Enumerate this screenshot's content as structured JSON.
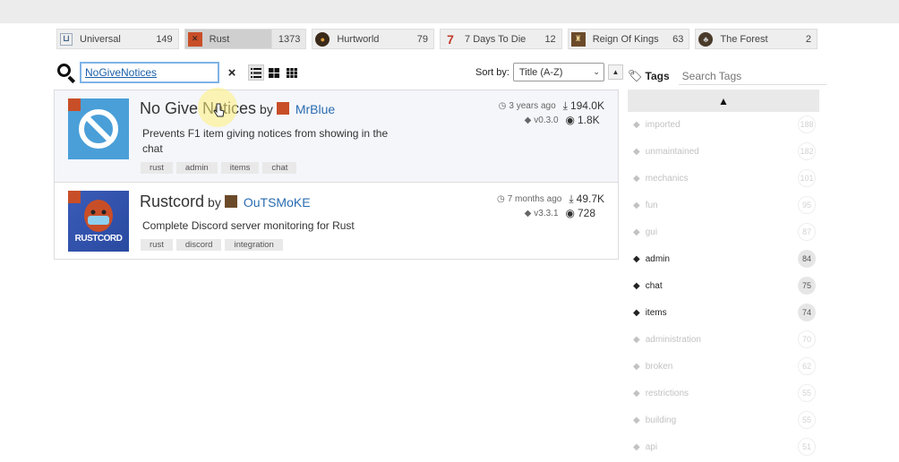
{
  "games": [
    {
      "name": "Universal",
      "count": "149",
      "icon": "universal-icon"
    },
    {
      "name": "Rust",
      "count": "1373",
      "icon": "rust-icon"
    },
    {
      "name": "Hurtworld",
      "count": "79",
      "icon": "hurtworld-icon"
    },
    {
      "name": "7 Days To Die",
      "count": "12",
      "icon": "seven-days-icon"
    },
    {
      "name": "Reign Of Kings",
      "count": "63",
      "icon": "reign-of-kings-icon"
    },
    {
      "name": "The Forest",
      "count": "2",
      "icon": "the-forest-icon"
    }
  ],
  "search": {
    "value": "NoGiveNotices",
    "clear": "×"
  },
  "sort": {
    "label": "Sort by:",
    "selected": "Title (A-Z)",
    "direction": "▲"
  },
  "plugins": [
    {
      "name": "No Give Notices",
      "by": "by",
      "author": "MrBlue",
      "description": "Prevents F1 item giving notices from showing in the chat",
      "tags": [
        "rust",
        "admin",
        "items",
        "chat"
      ],
      "updated": "3 years ago",
      "downloads": "194.0K",
      "version": "v0.3.0",
      "views": "1.8K"
    },
    {
      "name": "Rustcord",
      "by": "by",
      "author": "OuTSMoKE",
      "description": "Complete Discord server monitoring for Rust",
      "tags": [
        "rust",
        "discord",
        "integration"
      ],
      "updated": "7 months ago",
      "downloads": "49.7K",
      "version": "v3.3.1",
      "views": "728",
      "logo_text": "RUSTCORD"
    }
  ],
  "sidebar": {
    "title": "Tags",
    "search_placeholder": "Search Tags",
    "collapse": "▲",
    "tags": [
      {
        "name": "imported",
        "count": "188",
        "active": false
      },
      {
        "name": "unmaintained",
        "count": "182",
        "active": false
      },
      {
        "name": "mechanics",
        "count": "101",
        "active": false
      },
      {
        "name": "fun",
        "count": "95",
        "active": false
      },
      {
        "name": "gui",
        "count": "87",
        "active": false
      },
      {
        "name": "admin",
        "count": "84",
        "active": true
      },
      {
        "name": "chat",
        "count": "75",
        "active": true
      },
      {
        "name": "items",
        "count": "74",
        "active": true
      },
      {
        "name": "administration",
        "count": "70",
        "active": false
      },
      {
        "name": "broken",
        "count": "62",
        "active": false
      },
      {
        "name": "restrictions",
        "count": "55",
        "active": false
      },
      {
        "name": "building",
        "count": "55",
        "active": false
      },
      {
        "name": "api",
        "count": "51",
        "active": false
      }
    ]
  },
  "colors": {
    "accent": "#2b6cb0",
    "rust": "#c84e28",
    "thumb_blue": "#4a9fd8"
  }
}
